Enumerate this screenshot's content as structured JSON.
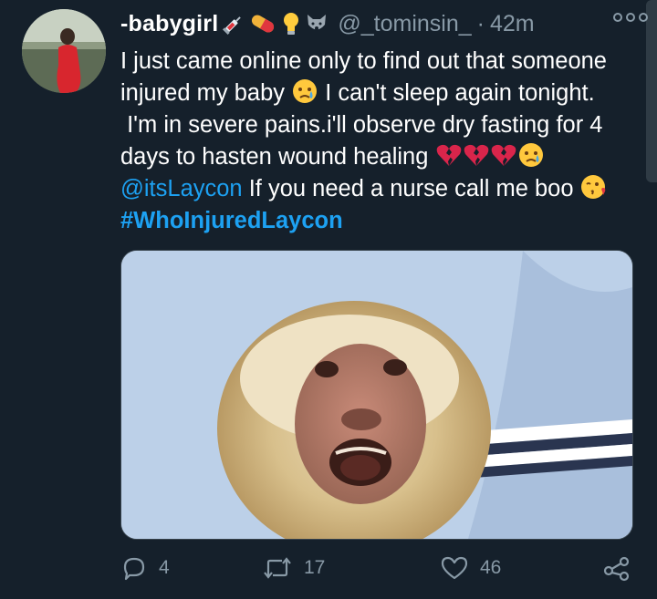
{
  "author": {
    "display_name": "-babygirl",
    "handle": "@_tominsin_",
    "separator": "·",
    "time": "42m"
  },
  "name_emojis": [
    "syringe-icon",
    "pill-icon",
    "lightbulb-icon",
    "wolf-face-icon"
  ],
  "tweet": {
    "line1": "I just came online only to find out that someone",
    "line2a": "injured my baby",
    "line2b": " I can't sleep again tonight.",
    "line3": " I'm in severe pains.i'll observe dry fasting for 4",
    "line4": "days to hasten wound healing",
    "mention": "@itsLaycon",
    "line5": " If you need a nurse call me boo",
    "hashtag": "#WhoInjuredLaycon"
  },
  "actions": {
    "replies": "4",
    "retweets": "17",
    "likes": "46"
  },
  "colors": {
    "background": "#15202b",
    "link": "#1da1f2",
    "muted": "#8899a6",
    "heart_broken": "#d9254b"
  }
}
